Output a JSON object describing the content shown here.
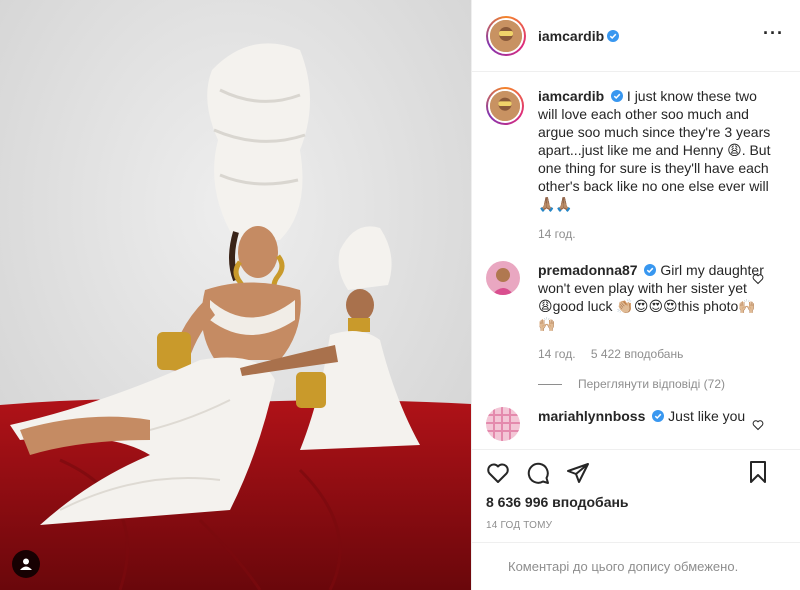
{
  "post": {
    "author": "iamcardib",
    "verified": true
  },
  "caption": {
    "username": "iamcardib",
    "text": "I just know these two will love each other soo much and argue soo much since they're 3 years apart...just like me and Henny 😩. But one thing for sure is they'll have each other's back like no one else ever will 🙏🏽🙏🏽",
    "time": "14 год."
  },
  "comments": [
    {
      "username": "premadonna87",
      "verified": true,
      "text": "Girl my daughter won't even play with her sister yet 😩good luck 👏🏼😍😍😍this photo🙌🏼🙌🏼",
      "time": "14 год.",
      "likes": "5 422 вподобань",
      "view_replies": "Переглянути відповіді (72)"
    },
    {
      "username": "mariahlynnboss",
      "verified": true,
      "text": "Just like you"
    }
  ],
  "actions": {
    "likes_count": "8 636 996 вподобань",
    "timestamp": "14 ГОД ТОМУ"
  },
  "comments_closed_text": "Коментарі до цього допису обмежено.",
  "icons": {
    "more": "more-options-icon",
    "like": "heart-icon",
    "comment": "comment-icon",
    "share": "share-icon",
    "save": "bookmark-icon",
    "tag": "user-tag-icon"
  },
  "colors": {
    "verified": "#3897f0",
    "muted_text": "#8e8e8e",
    "backdrop_red": "#9e0f14"
  }
}
